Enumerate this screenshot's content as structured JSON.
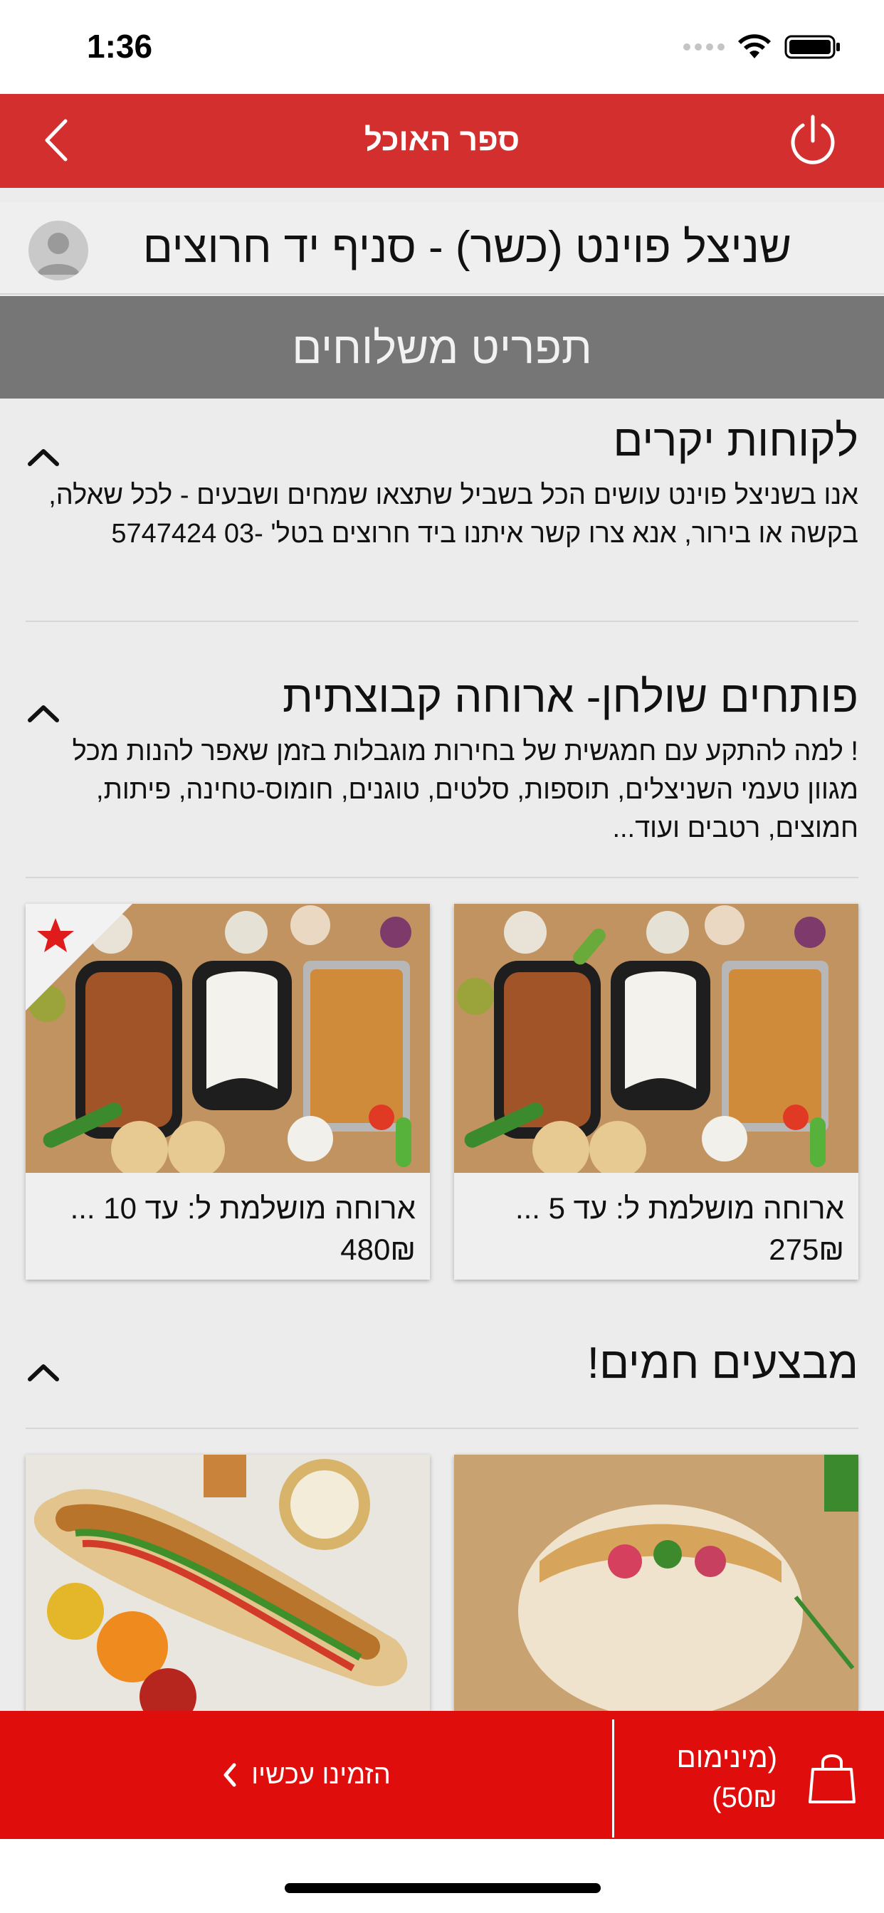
{
  "status_bar": {
    "time": "1:36"
  },
  "nav": {
    "title": "ספר האוכל"
  },
  "restaurant": {
    "name": "שניצל פוינט (כשר) - סניף יד חרוצים"
  },
  "menu_banner": {
    "title": "תפריט משלוחים"
  },
  "sections": [
    {
      "title": "לקוחות יקרים",
      "description": "אנו בשניצל פוינט עושים הכל בשביל שתצאו שמחים ושבעים - לכל שאלה, בקשה או בירור, אנא צרו קשר איתנו ביד חרוצים בטל' -03 5747424"
    },
    {
      "title": "פותחים שולחן- ארוחה קבוצתית",
      "description": "! למה להתקע עם חמגשית של בחירות מוגבלות בזמן שאפר להנות מכל מגוון טעמי השניצלים, תוספות, סלטים, טוגנים, חומוס-טחינה, פיתות, חמוצים, רטבים ועוד...",
      "items": [
        {
          "name": "ארוחה מושלמת ל: עד 5 ...",
          "price": "275₪",
          "featured": false
        },
        {
          "name": "ארוחה מושלמת ל: עד 10 ...",
          "price": "480₪",
          "featured": true
        }
      ]
    },
    {
      "title": "מבצעים חמים!"
    }
  ],
  "bottom_bar": {
    "order_label": "הזמינו עכשיו",
    "minimum_line1": "(מינימום",
    "minimum_line2": "50₪)"
  },
  "icons": {
    "back": "chevron-left-icon",
    "power": "power-icon",
    "avatar": "user-avatar-icon",
    "collapse": "chevron-up-icon",
    "featured": "star-icon",
    "cart": "shopping-bag-icon"
  },
  "colors": {
    "nav": "#d32f2f",
    "bottom_bar": "#e00d0d",
    "banner": "#767676",
    "star": "#e01b1b"
  }
}
